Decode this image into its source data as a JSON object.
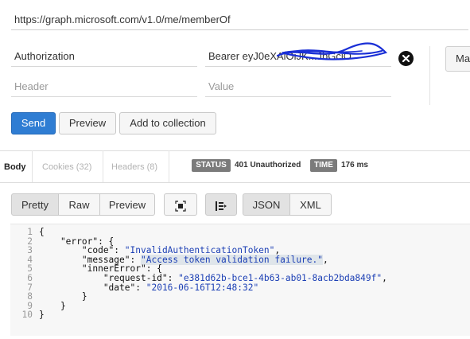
{
  "request": {
    "url": "https://graph.microsoft.com/v1.0/me/memberOf",
    "headers": [
      {
        "key": "Authorization",
        "value": "Bearer eyJ0eXAiOiJK...JbGciO"
      }
    ],
    "new_header_placeholder": "Header",
    "new_value_placeholder": "Value",
    "side_button_label": "Ma"
  },
  "actions": {
    "send": "Send",
    "preview": "Preview",
    "add_to_collection": "Add to collection"
  },
  "response_tabs": [
    {
      "label": "Body",
      "active": true
    },
    {
      "label": "Cookies (32)",
      "active": false
    },
    {
      "label": "Headers (8)",
      "active": false
    }
  ],
  "status": {
    "label": "STATUS",
    "value": "401 Unauthorized"
  },
  "time": {
    "label": "TIME",
    "value": "176 ms"
  },
  "view_modes": [
    "Pretty",
    "Raw",
    "Preview"
  ],
  "formats": [
    "JSON",
    "XML"
  ],
  "active_view": "Pretty",
  "active_format": "JSON",
  "line_numbers": [
    "1",
    "2",
    "3",
    "4",
    "5",
    "6",
    "7",
    "8",
    "9",
    "10"
  ],
  "response_body": {
    "code": "InvalidAuthenticationToken",
    "message": "Access token validation failure.",
    "request_id": "e381d62b-bce1-4b63-ab01-8acb2bda849f",
    "date": "2016-06-16T12:48:32"
  },
  "colors": {
    "primary": "#2f7dd3",
    "badge": "#7b7b7b",
    "json_string": "#1d40b5",
    "redaction": "#1a2fd6"
  }
}
